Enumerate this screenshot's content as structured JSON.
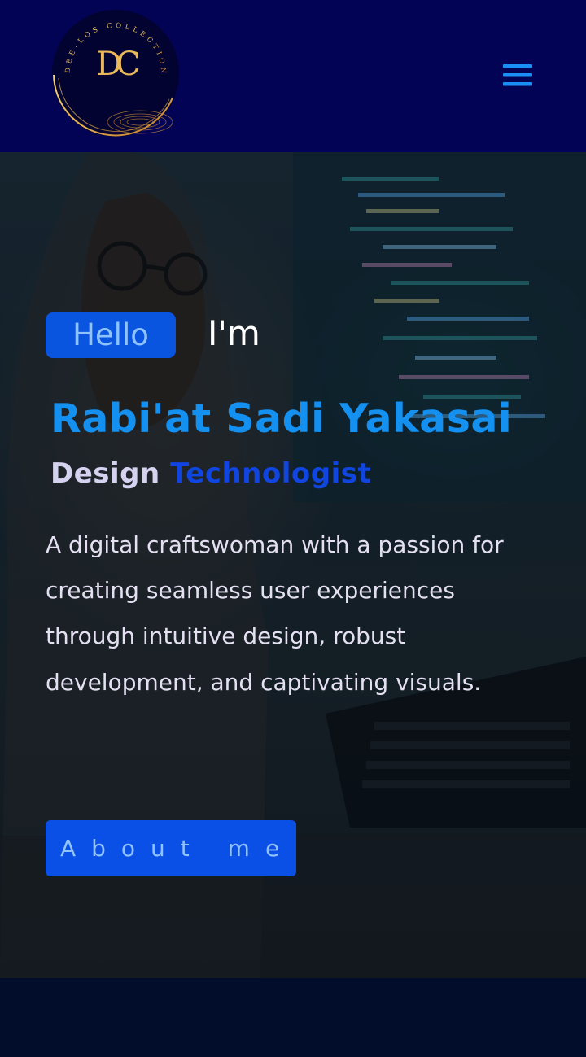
{
  "brand": {
    "monogram": "DC",
    "ring_text": "DEE-LOS COLLECTION"
  },
  "nav": {
    "menu_icon": "hamburger-menu-icon"
  },
  "hero": {
    "badge": "Hello",
    "intro": "I'm",
    "name": "Rabi'at Sadi Yakasai",
    "role_part1": "Design",
    "role_part2": "Technologist",
    "description": "A digital craftswoman with a passion for creating seamless user experiences through intuitive design, robust development, and captivating visuals.",
    "cta_label": "About me",
    "background_image": "woman-in-hijab-at-computer-photo"
  },
  "colors": {
    "navbar": "#020354",
    "accent": "#0a55e0",
    "name": "#1390f0",
    "menu_icon": "#1a8ff5",
    "logo_gold": "#e0a94a"
  }
}
